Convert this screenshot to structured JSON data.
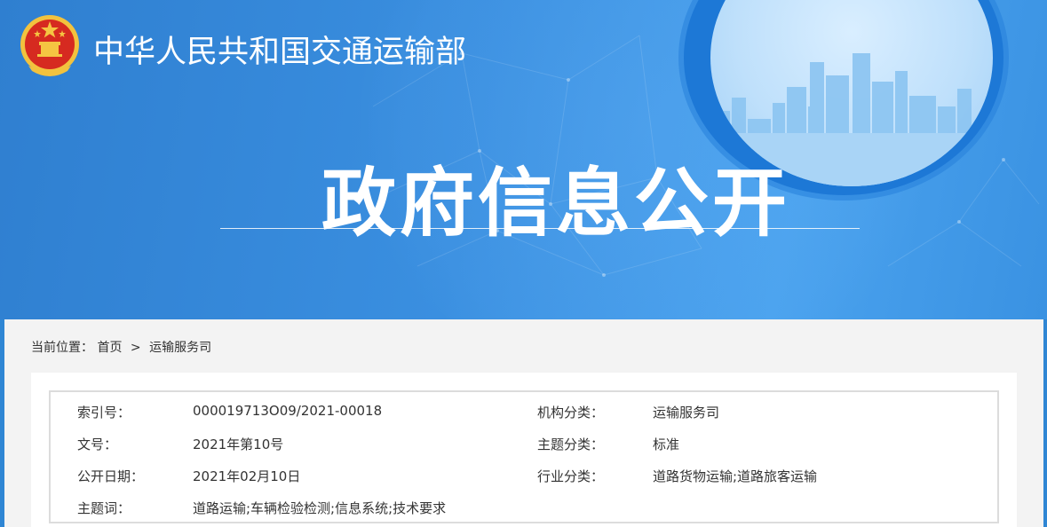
{
  "header": {
    "site_title": "中华人民共和国交通运输部",
    "banner_title": "政府信息公开"
  },
  "breadcrumb": {
    "prefix": "当前位置：",
    "home": "首页",
    "separator": ">",
    "current": "运输服务司"
  },
  "meta": {
    "rows": [
      {
        "k1": "索引号：",
        "v1": "000019713O09/2021-00018",
        "k2": "机构分类：",
        "v2": "运输服务司"
      },
      {
        "k1": "文号：",
        "v1": "2021年第10号",
        "k2": "主题分类：",
        "v2": "标准"
      },
      {
        "k1": "公开日期：",
        "v1": "2021年02月10日",
        "k2": "行业分类：",
        "v2": "道路货物运输;道路旅客运输"
      },
      {
        "k1": "主题词：",
        "v1": "道路运输;车辆检验检测;信息系统;技术要求",
        "k2": "",
        "v2": ""
      }
    ]
  },
  "colors": {
    "banner_blue": "#2f86d4",
    "panel_gray": "#f3f3f3",
    "emblem_red": "#d62a20",
    "emblem_gold": "#f5c542"
  }
}
